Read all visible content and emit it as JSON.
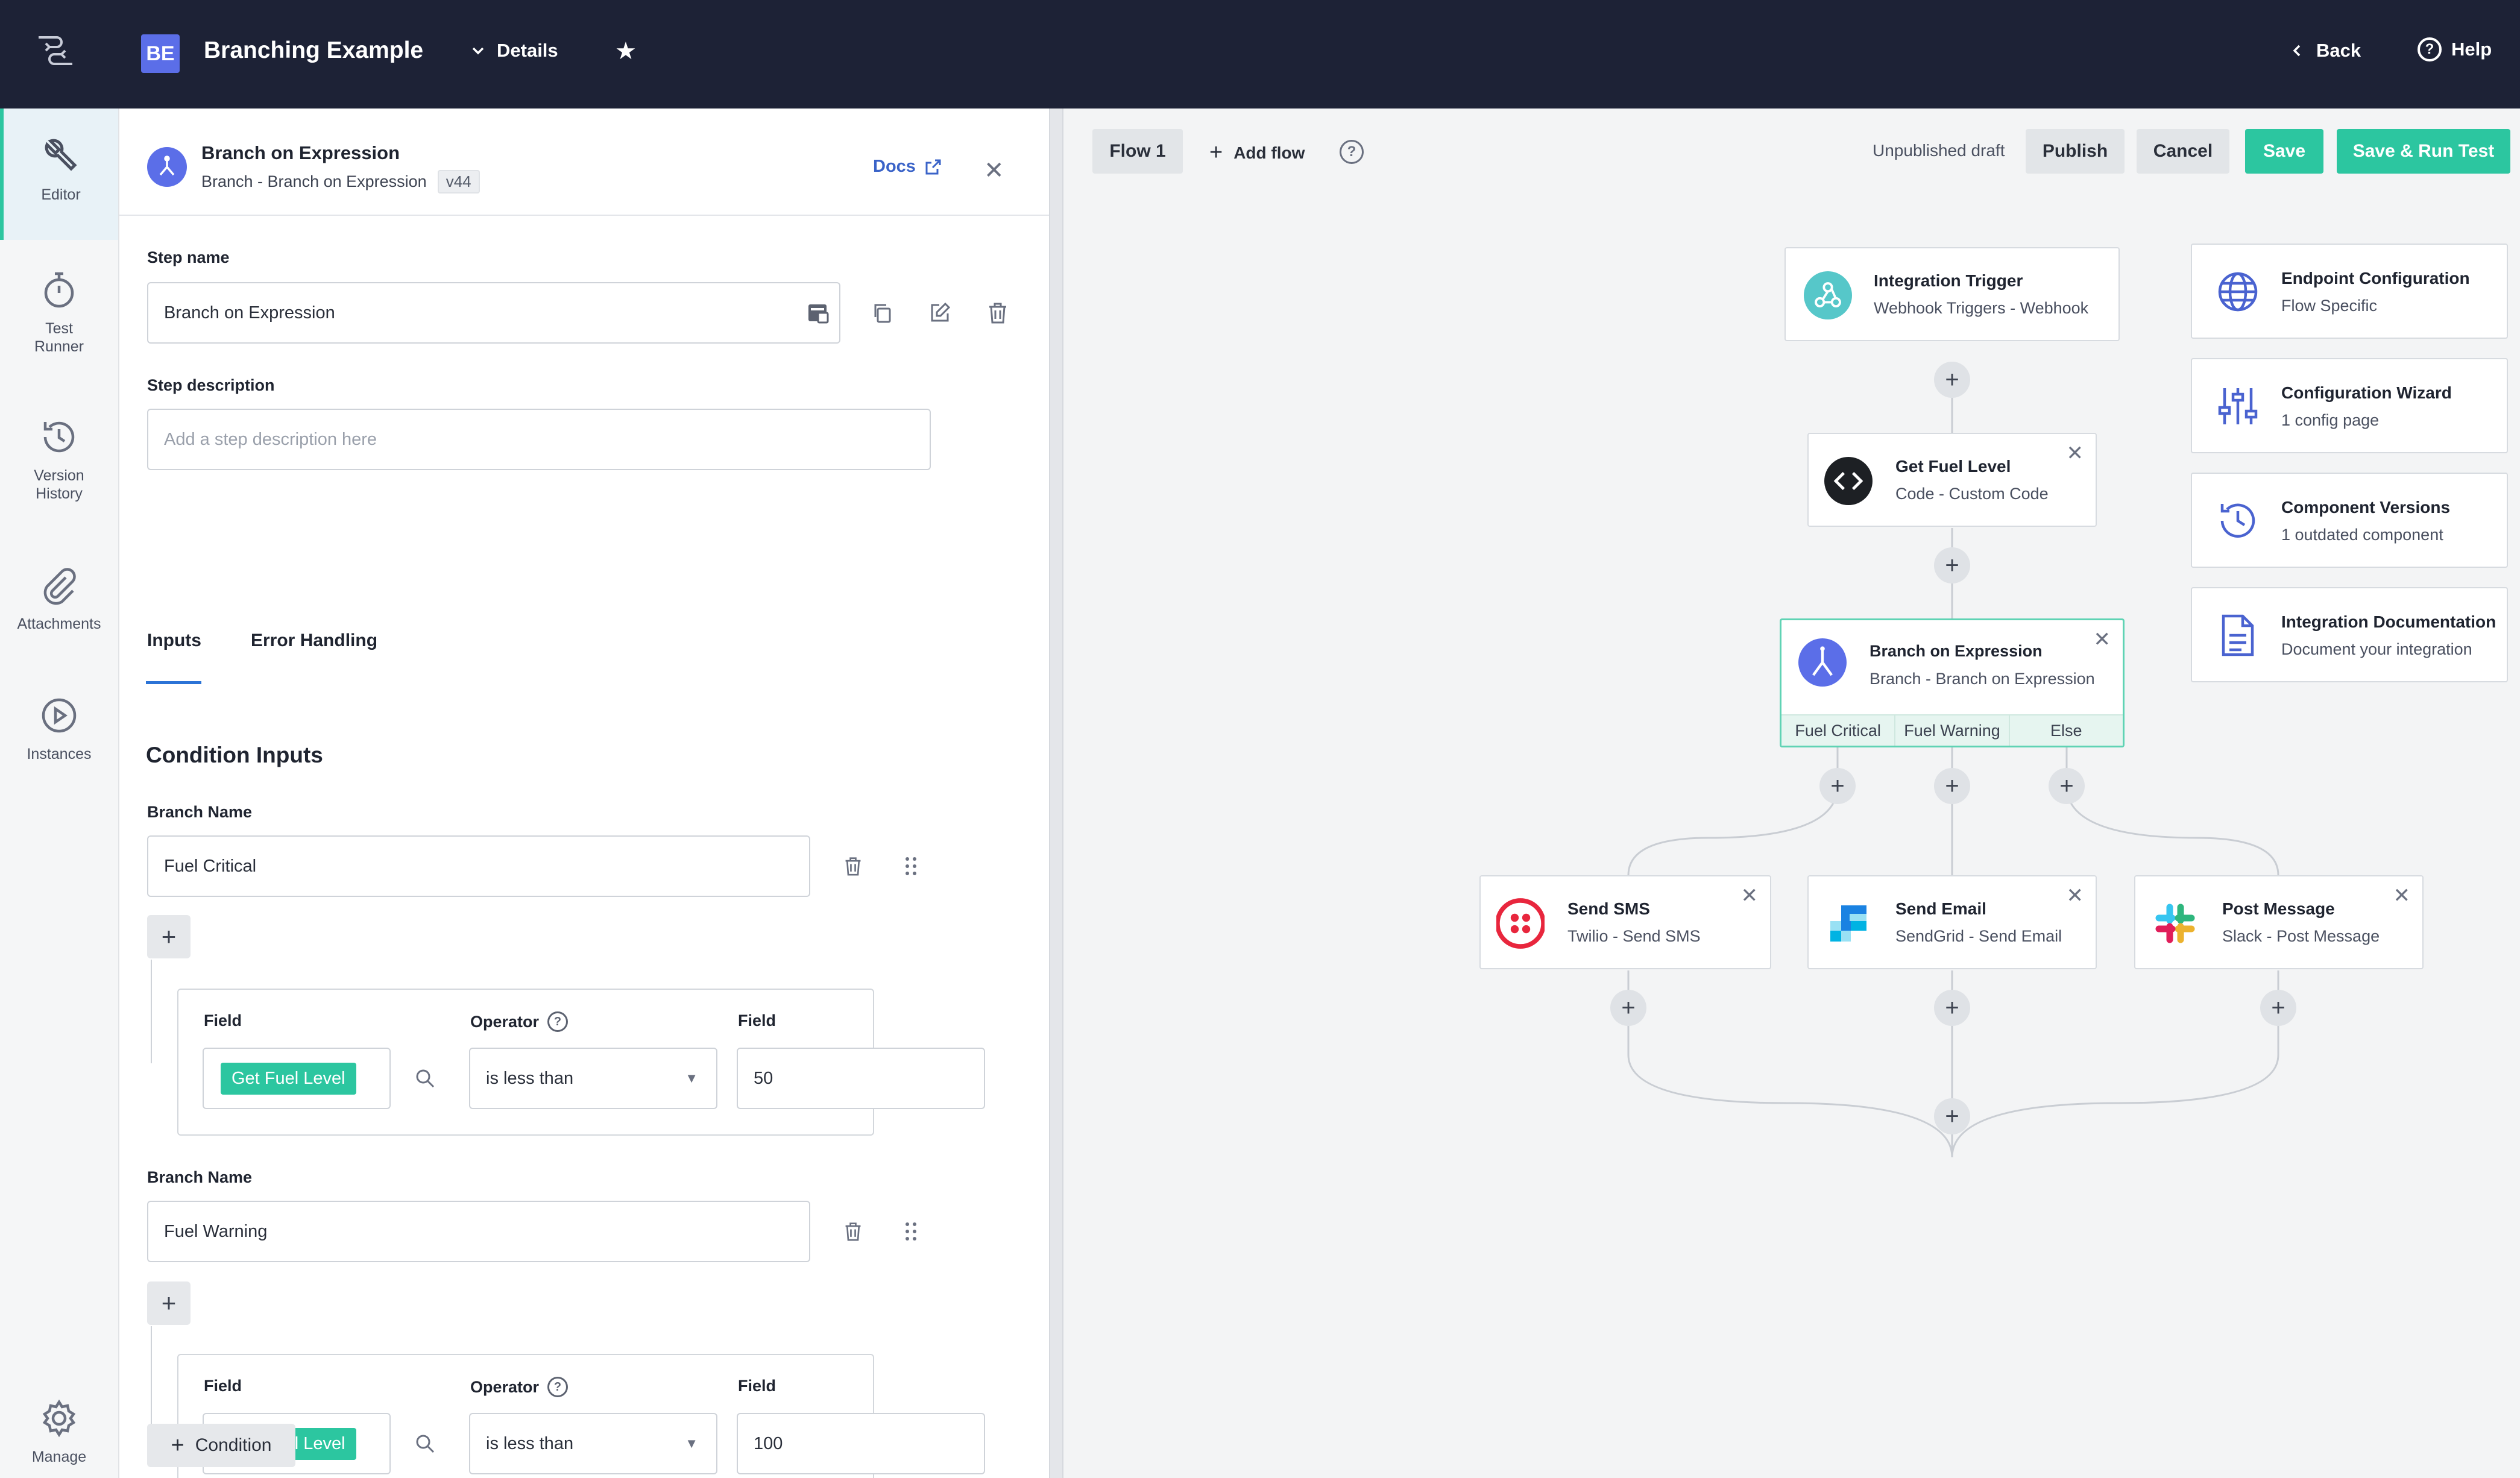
{
  "topbar": {
    "badge": "BE",
    "title": "Branching Example",
    "details_label": "Details",
    "back_label": "Back",
    "help_label": "Help"
  },
  "nav": {
    "items": [
      {
        "label": "Editor"
      },
      {
        "label": "Test Runner"
      },
      {
        "label": "Version History"
      },
      {
        "label": "Attachments"
      },
      {
        "label": "Instances"
      },
      {
        "label": "Manage"
      }
    ]
  },
  "step": {
    "title": "Branch on Expression",
    "subtitle": "Branch - Branch on Expression",
    "version": "v44",
    "docs_label": "Docs",
    "name_label": "Step name",
    "name_value": "Branch on Expression",
    "description_label": "Step description",
    "description_placeholder": "Add a step description here",
    "tabs": [
      "Inputs",
      "Error Handling"
    ],
    "section_title": "Condition Inputs",
    "branches": [
      {
        "label": "Branch Name",
        "value": "Fuel Critical",
        "field_label": "Field",
        "operator_label": "Operator",
        "field2_label": "Field",
        "chip": "Get Fuel Level",
        "operator": "is less than",
        "compare_value": "50"
      },
      {
        "label": "Branch Name",
        "value": "Fuel Warning",
        "field_label": "Field",
        "operator_label": "Operator",
        "field2_label": "Field",
        "chip": "Get Fuel Level",
        "operator": "is less than",
        "compare_value": "100"
      }
    ],
    "condition_button": "Condition"
  },
  "canvas": {
    "flow_tab": "Flow 1",
    "add_flow": "Add flow",
    "status": "Unpublished draft",
    "publish": "Publish",
    "cancel": "Cancel",
    "save": "Save",
    "save_run": "Save & Run Test",
    "nodes": {
      "trigger": {
        "title": "Integration Trigger",
        "sub": "Webhook Triggers - Webhook"
      },
      "fuel": {
        "title": "Get Fuel Level",
        "sub": "Code - Custom Code"
      },
      "branch": {
        "title": "Branch on Expression",
        "sub": "Branch - Branch on Expression",
        "branches": [
          "Fuel Critical",
          "Fuel Warning",
          "Else"
        ]
      },
      "sms": {
        "title": "Send SMS",
        "sub": "Twilio - Send SMS"
      },
      "email": {
        "title": "Send Email",
        "sub": "SendGrid - Send Email"
      },
      "slack": {
        "title": "Post Message",
        "sub": "Slack - Post Message"
      }
    },
    "side_cards": [
      {
        "title": "Endpoint Configuration",
        "sub": "Flow Specific"
      },
      {
        "title": "Configuration Wizard",
        "sub": "1 config page"
      },
      {
        "title": "Component Versions",
        "sub": "1 outdated component"
      },
      {
        "title": "Integration Documentation",
        "sub": "Document your integration"
      }
    ]
  },
  "colors": {
    "topbar": "#1d2236",
    "accent_green": "#2cc6a0",
    "accent_blue": "#5b6ee8"
  }
}
